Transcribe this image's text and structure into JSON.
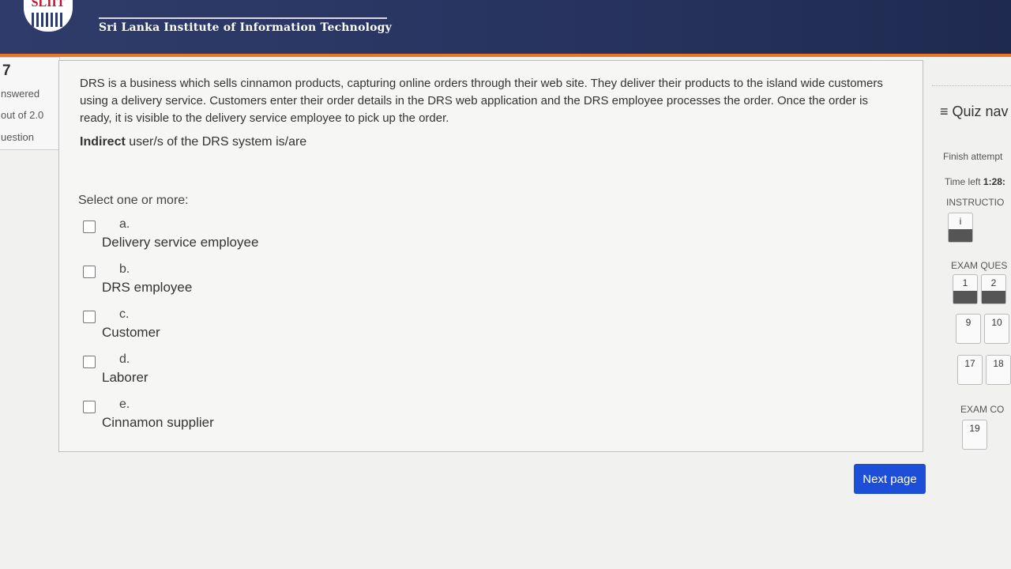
{
  "header": {
    "institute_name": "Sri Lanka Institute of Information Technology",
    "logo_text": "SLIIT"
  },
  "question_info": {
    "number": "7",
    "status": "nswered",
    "marks": "out of 2.0",
    "flag": "uestion"
  },
  "question": {
    "text": "DRS is a business which sells cinnamon products, capturing online orders through their web site. They deliver their products to the island wide customers using a delivery service. Customers enter their order details in the DRS web application and the DRS employee processes the order. Once the order is ready, it is visible to the delivery service employee to pick up the order.",
    "prompt_bold": "Indirect",
    "prompt_rest": " user/s of the DRS system is/are",
    "select_label": "Select one or more:",
    "options": [
      {
        "letter": "a.",
        "text": "Delivery service employee"
      },
      {
        "letter": "b.",
        "text": "DRS employee"
      },
      {
        "letter": "c.",
        "text": "Customer"
      },
      {
        "letter": "d.",
        "text": "Laborer"
      },
      {
        "letter": "e.",
        "text": "Cinnamon supplier"
      }
    ]
  },
  "quiz_nav": {
    "title": "≡ Quiz nav",
    "finish_attempt": "Finish attempt",
    "time_left_label": "Time left ",
    "time_left_value": "1:28:",
    "instructions_label": "INSTRUCTIO",
    "instructions_button": "i",
    "exam_questions_label": "EXAM QUES",
    "question_buttons": [
      "1",
      "2",
      "9",
      "10",
      "17",
      "18"
    ],
    "exam_conclusion_label": "EXAM CO",
    "conclusion_button": "19"
  },
  "footer": {
    "next_label": "Next page"
  }
}
